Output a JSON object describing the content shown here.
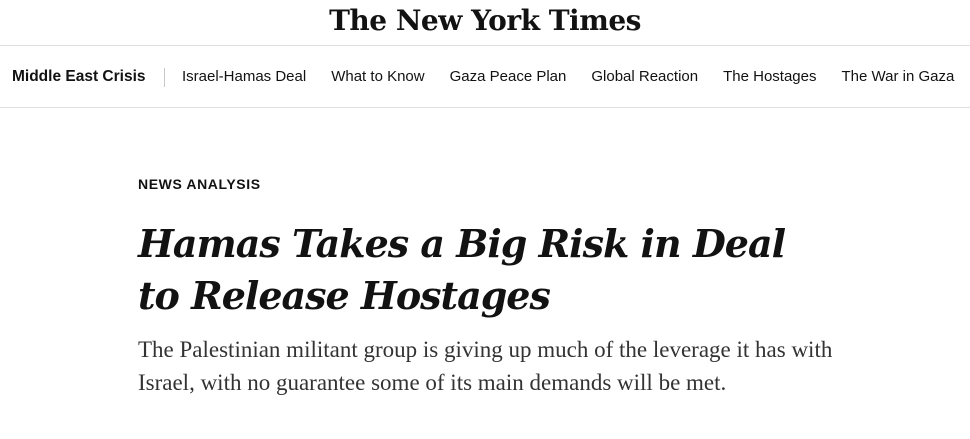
{
  "masthead": {
    "logo_text": "The New York Times"
  },
  "subnav": {
    "section_title": "Middle East Crisis",
    "links": [
      "Israel-Hamas Deal",
      "What to Know",
      "Gaza Peace Plan",
      "Global Reaction",
      "The Hostages",
      "The War in Gaza"
    ]
  },
  "article": {
    "kicker": "NEWS ANALYSIS",
    "headline": "Hamas Takes a Big Risk in Deal to Release Hostages",
    "summary": "The Palestinian militant group is giving up much of the leverage it has with Israel, with no guarantee some of its main demands will be met."
  }
}
